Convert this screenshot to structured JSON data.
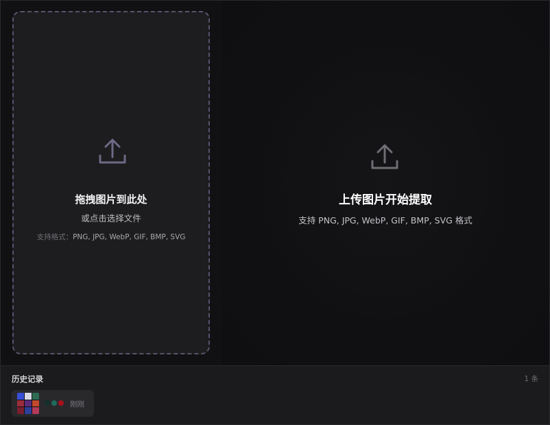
{
  "dropzone": {
    "icon": "upload-icon",
    "title": "拖拽图片到此处",
    "subtitle": "或点击选择文件",
    "formats_label": "支持格式：",
    "formats_value": "PNG, JPG, WebP, GIF, BMP, SVG"
  },
  "preview": {
    "icon": "upload-icon",
    "title": "上传图片开始提取",
    "subtitle": "支持 PNG, JPG, WebP, GIF, BMP, SVG 格式"
  },
  "history": {
    "title": "历史记录",
    "count": "1 条",
    "items": [
      {
        "time": "刚刚",
        "thumbnail_colors": [
          "#3a4fd8",
          "#d9d9e6",
          "#2f6b52",
          "#9a2c3c",
          "#5a2b7c",
          "#c04a2d",
          "#7a1f2f",
          "#2c3f9a",
          "#b23a5a"
        ],
        "palette": [
          "#13302a",
          "#1f6b5e",
          "#a8101e"
        ]
      }
    ]
  },
  "colors": {
    "background": "#111113",
    "dropzone_bg": "#1d1d1f",
    "dropzone_border": "#56546e",
    "icon": "#6c6a86",
    "history_bg": "#1b1b1d"
  }
}
